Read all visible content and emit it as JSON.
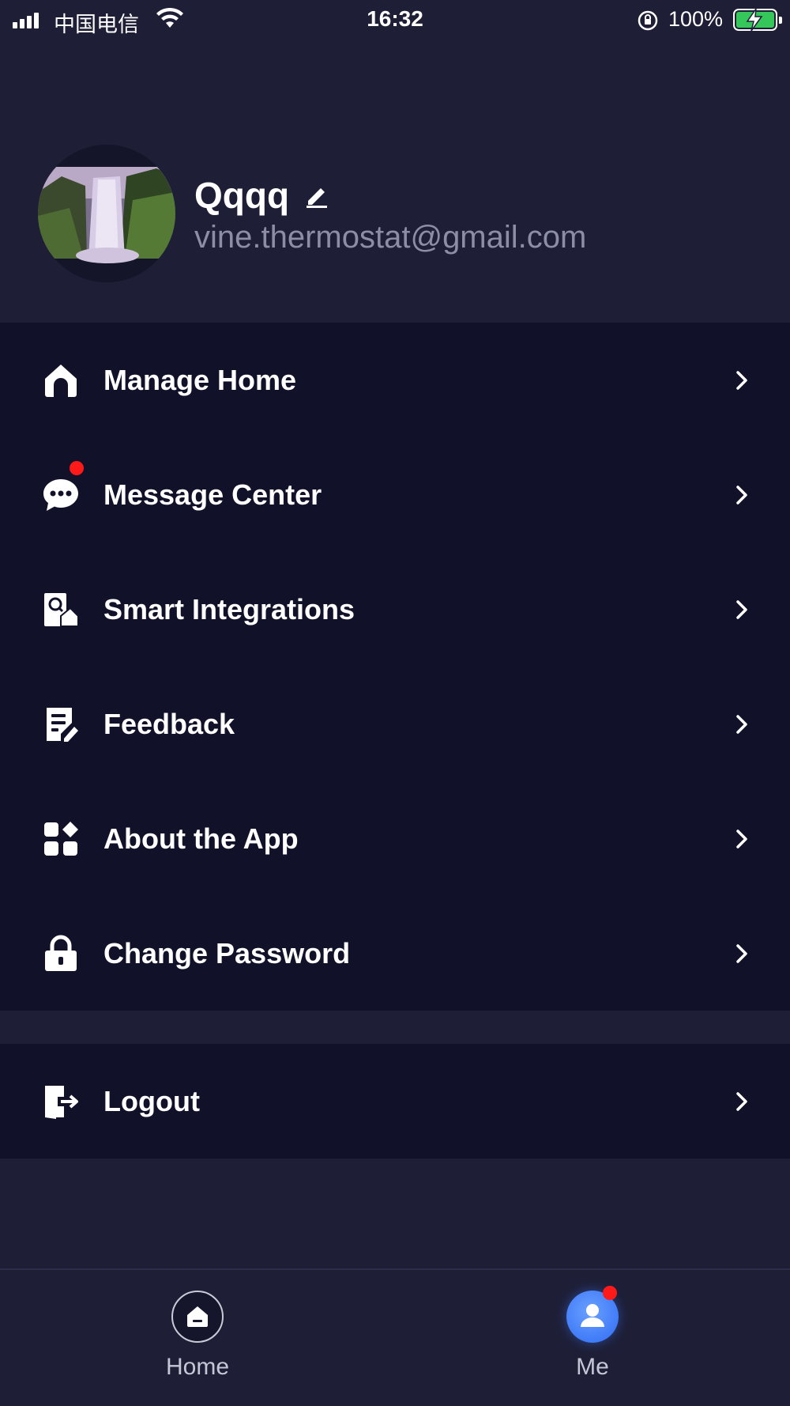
{
  "status_bar": {
    "carrier": "中国电信",
    "time": "16:32",
    "battery": "100%"
  },
  "profile": {
    "username": "Qqqq",
    "email": "vine.thermostat@gmail.com"
  },
  "menu": {
    "items": [
      {
        "label": "Manage Home",
        "icon": "home-icon"
      },
      {
        "label": "Message Center",
        "icon": "chat-bubble-icon",
        "badge": true
      },
      {
        "label": "Smart Integrations",
        "icon": "smart-integration-icon"
      },
      {
        "label": "Feedback",
        "icon": "feedback-icon"
      },
      {
        "label": "About the App",
        "icon": "apps-grid-icon"
      },
      {
        "label": "Change Password",
        "icon": "lock-icon"
      }
    ],
    "logout": {
      "label": "Logout",
      "icon": "logout-icon"
    }
  },
  "tab_bar": {
    "tabs": [
      {
        "label": "Home",
        "icon": "home-tab-icon"
      },
      {
        "label": "Me",
        "icon": "person-icon",
        "active": true,
        "badge": true
      }
    ]
  },
  "colors": {
    "background": "#1e1f37",
    "menu_background": "#11122a",
    "accent": "#3b78ff",
    "badge": "#ff1a1a",
    "secondary_text": "#8c8ea6"
  }
}
